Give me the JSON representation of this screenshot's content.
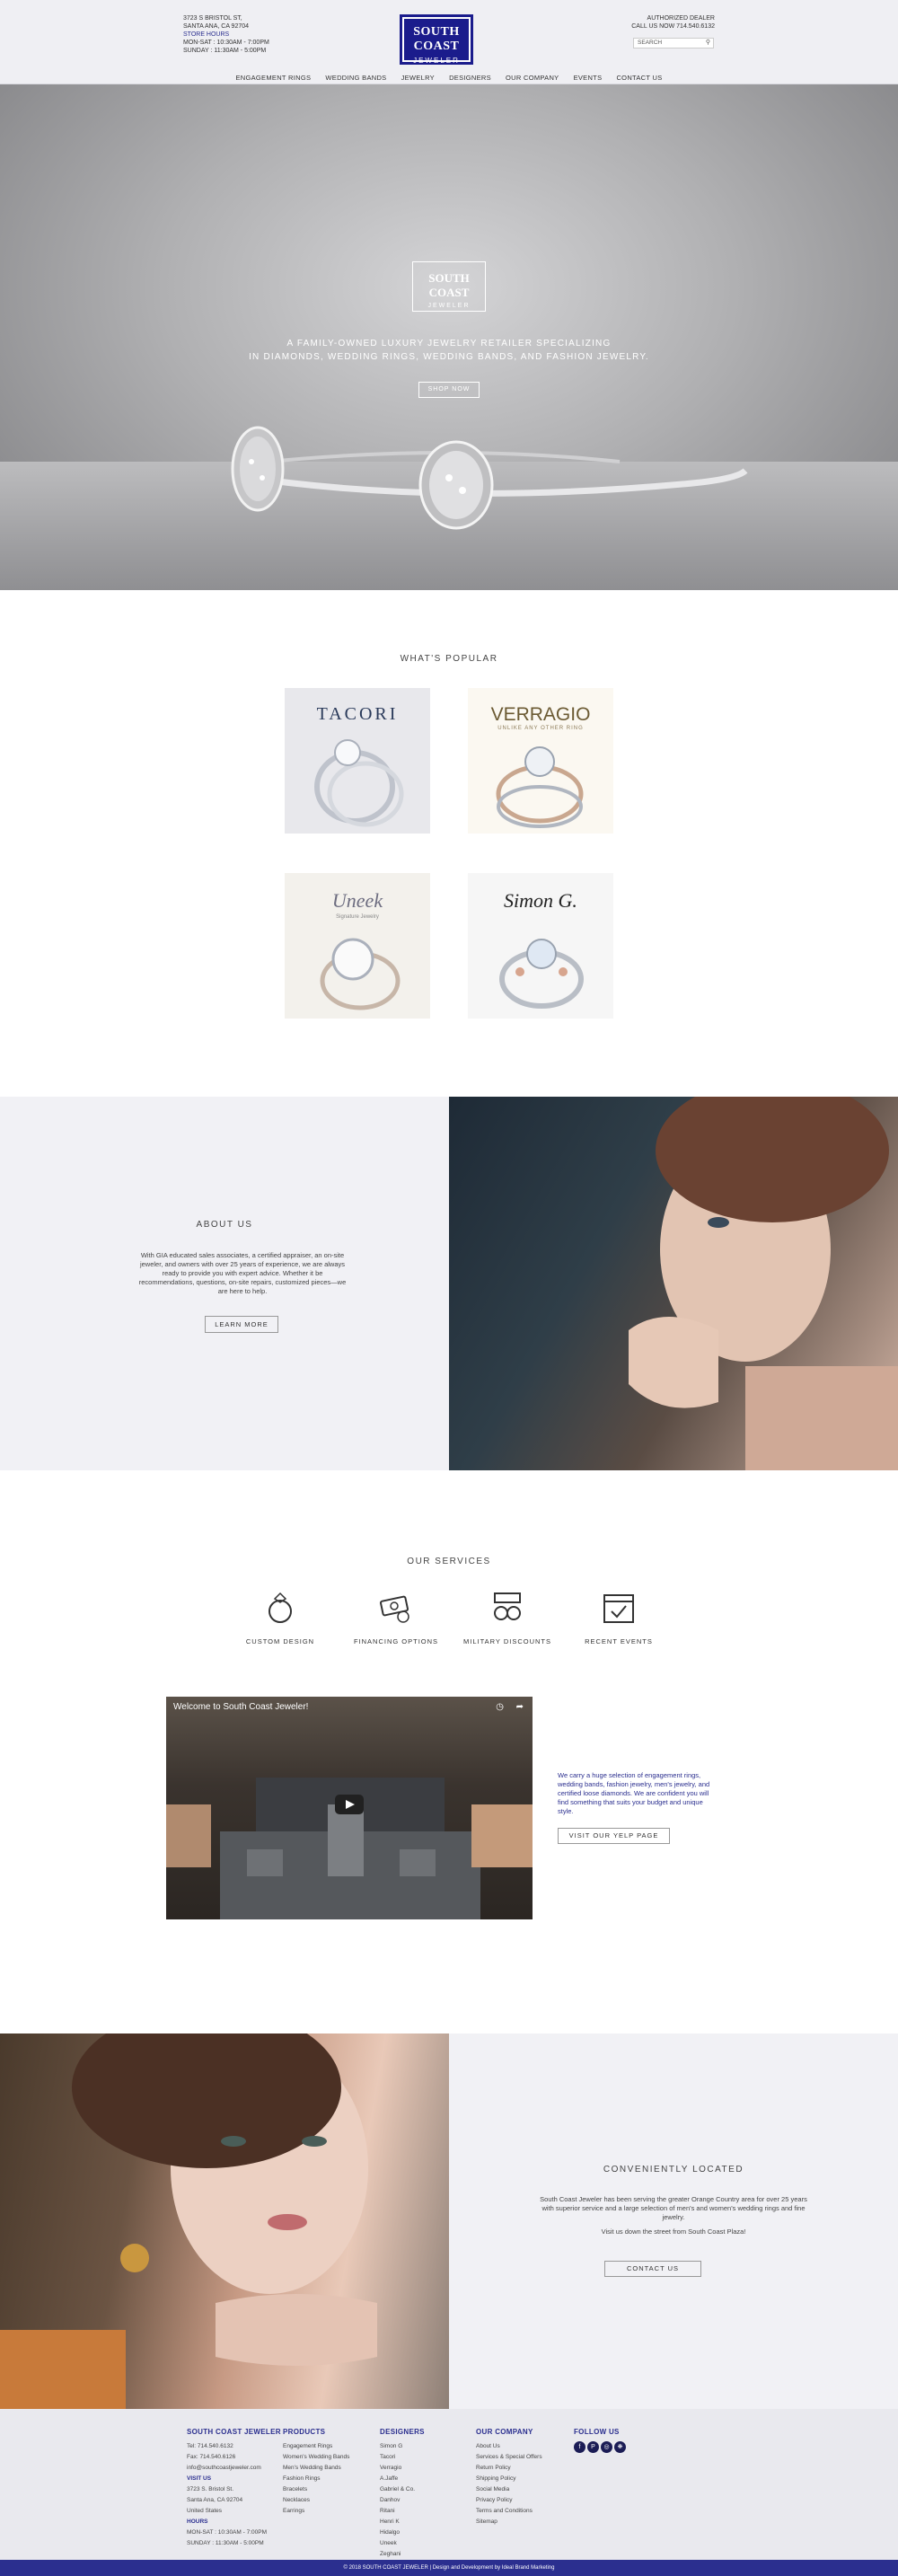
{
  "header": {
    "address_line1": "3723 S BRISTOL ST,",
    "address_line2": "SANTA ANA, CA 92704",
    "hours_title": "STORE HOURS",
    "hours_weekday": "MON-SAT : 10:30AM - 7:00PM",
    "hours_sunday": "SUNDAY : 11:30AM - 5:00PM",
    "logo_line1": "SOUTH COAST",
    "logo_line2": "JEWELER",
    "authorized": "AUTHORIZED DEALER",
    "call_us": "CALL US NOW 714.540.6132",
    "search_placeholder": "SEARCH"
  },
  "nav": [
    "ENGAGEMENT RINGS",
    "WEDDING BANDS",
    "JEWELRY",
    "DESIGNERS",
    "OUR COMPANY",
    "EVENTS",
    "CONTACT US"
  ],
  "hero": {
    "logo_line1": "SOUTH COAST",
    "logo_line2": "JEWELER",
    "tagline1": "A FAMILY-OWNED LUXURY JEWELRY RETAILER SPECIALIZING",
    "tagline2": "IN DIAMONDS, WEDDING RINGS, WEDDING BANDS, AND FASHION JEWELRY.",
    "button": "SHOP NOW"
  },
  "popular": {
    "title": "WHAT'S POPULAR",
    "brands": [
      {
        "name": "TACORI",
        "tagline": ""
      },
      {
        "name": "VERRAGIO",
        "tagline": "UNLIKE ANY OTHER RING"
      },
      {
        "name": "Uneek",
        "tagline": "Signature Jewelry"
      },
      {
        "name": "Simon G.",
        "tagline": ""
      }
    ]
  },
  "about": {
    "title": "ABOUT US",
    "text": "With GIA educated sales associates, a certified appraiser, an on-site jeweler, and owners with over 25 years of experience, we are always ready to provide you with expert advice. Whether it be recommendations, questions, on-site repairs, customized pieces—we are here to help.",
    "button": "LEARN MORE"
  },
  "services": {
    "title": "OUR SERVICES",
    "items": [
      {
        "label": "CUSTOM DESIGN",
        "icon": "ring-icon"
      },
      {
        "label": "FINANCING OPTIONS",
        "icon": "money-icon"
      },
      {
        "label": "MILITARY DISCOUNTS",
        "icon": "medal-icon"
      },
      {
        "label": "RECENT EVENTS",
        "icon": "calendar-icon"
      }
    ]
  },
  "video": {
    "title": "Welcome to South Coast Jeweler!",
    "text": "We carry a huge selection of engagement rings, wedding bands, fashion jewelry, men's jewelry, and certified loose diamonds. We are confident you will find something that suits your budget and unique style.",
    "button": "VISIT OUR YELP PAGE"
  },
  "located": {
    "title": "CONVENIENTLY LOCATED",
    "text1": "South Coast Jeweler has been serving the greater Orange Country area for over 25 years with superior service and a large selection of men's and women's wedding rings and fine jewelry.",
    "text2": "Visit us down the street from South Coast Plaza!",
    "button": "CONTACT US"
  },
  "footer": {
    "col1": {
      "title": "SOUTH COAST JEWELER",
      "tel": "Tel: 714.540.6132",
      "fax": "Fax: 714.540.6126",
      "email": "info@southcoastjeweler.com",
      "visit_title": "VISIT US",
      "addr1": "3723 S. Bristol St.",
      "addr2": "Santa Ana, CA 92704",
      "addr3": "United States",
      "hours_title": "HOURS",
      "hours1": "MON-SAT : 10:30AM - 7:00PM",
      "hours2": "SUNDAY : 11:30AM - 5:00PM"
    },
    "products": {
      "title": "PRODUCTS",
      "items": [
        "Engagement Rings",
        "Women's Wedding Bands",
        "Men's Wedding Bands",
        "Fashion Rings",
        "Bracelets",
        "Necklaces",
        "Earrings"
      ]
    },
    "designers": {
      "title": "DESIGNERS",
      "items": [
        "Simon G",
        "Tacori",
        "Verragio",
        "A.Jaffe",
        "Gabriel & Co.",
        "Danhov",
        "Ritani",
        "Henri K",
        "Hidalgo",
        "Uneek",
        "Zeghani"
      ]
    },
    "company": {
      "title": "OUR COMPANY",
      "items": [
        "About Us",
        "Services & Special Offers",
        "Return Policy",
        "Shipping Policy",
        "Social Media",
        "Privacy Policy",
        "Terms and Conditions",
        "Sitemap"
      ]
    },
    "follow": {
      "title": "FOLLOW US",
      "icons": [
        "facebook-icon",
        "pinterest-icon",
        "instagram-icon",
        "yelp-icon"
      ]
    },
    "copyright": "© 2018 SOUTH COAST JEWELER | Design and Development by Ideal Brand Marketing"
  }
}
